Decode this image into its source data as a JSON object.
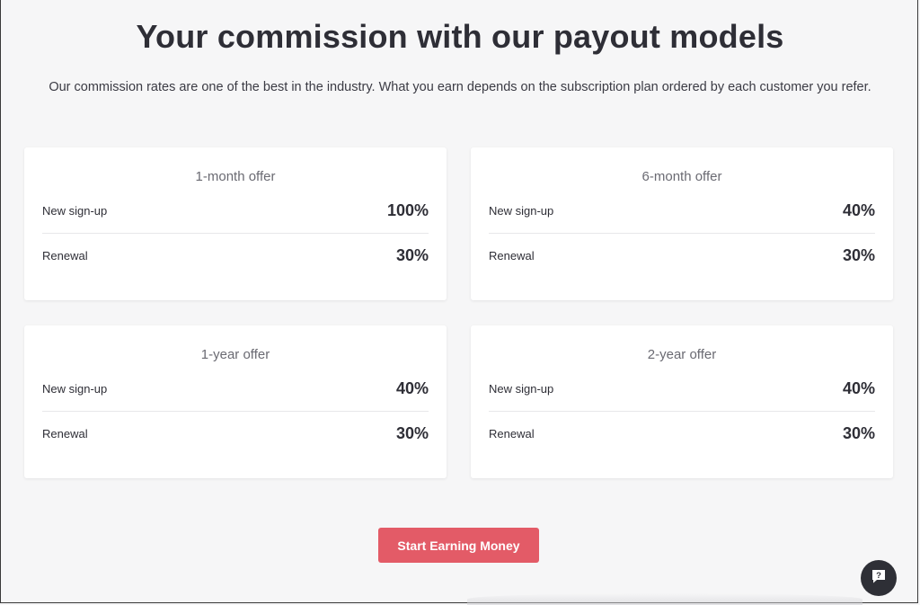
{
  "header": {
    "title": "Your commission with our payout models",
    "subtitle": "Our commission rates are one of the best in the industry. What you earn depends on the subscription plan ordered by each customer you refer."
  },
  "offers": [
    {
      "title": "1-month offer",
      "rows": [
        {
          "label": "New sign-up",
          "value": "100%"
        },
        {
          "label": "Renewal",
          "value": "30%"
        }
      ]
    },
    {
      "title": "6-month offer",
      "rows": [
        {
          "label": "New sign-up",
          "value": "40%"
        },
        {
          "label": "Renewal",
          "value": "30%"
        }
      ]
    },
    {
      "title": "1-year offer",
      "rows": [
        {
          "label": "New sign-up",
          "value": "40%"
        },
        {
          "label": "Renewal",
          "value": "30%"
        }
      ]
    },
    {
      "title": "2-year offer",
      "rows": [
        {
          "label": "New sign-up",
          "value": "40%"
        },
        {
          "label": "Renewal",
          "value": "30%"
        }
      ]
    }
  ],
  "cta": {
    "label": "Start Earning Money"
  },
  "help_widget": {
    "icon": "help-chat-icon",
    "glyph": "?"
  },
  "colors": {
    "background": "#f6f6f7",
    "card": "#ffffff",
    "accent": "#e35b67",
    "text": "#2e2e36",
    "help_bg": "#2e2f36"
  }
}
